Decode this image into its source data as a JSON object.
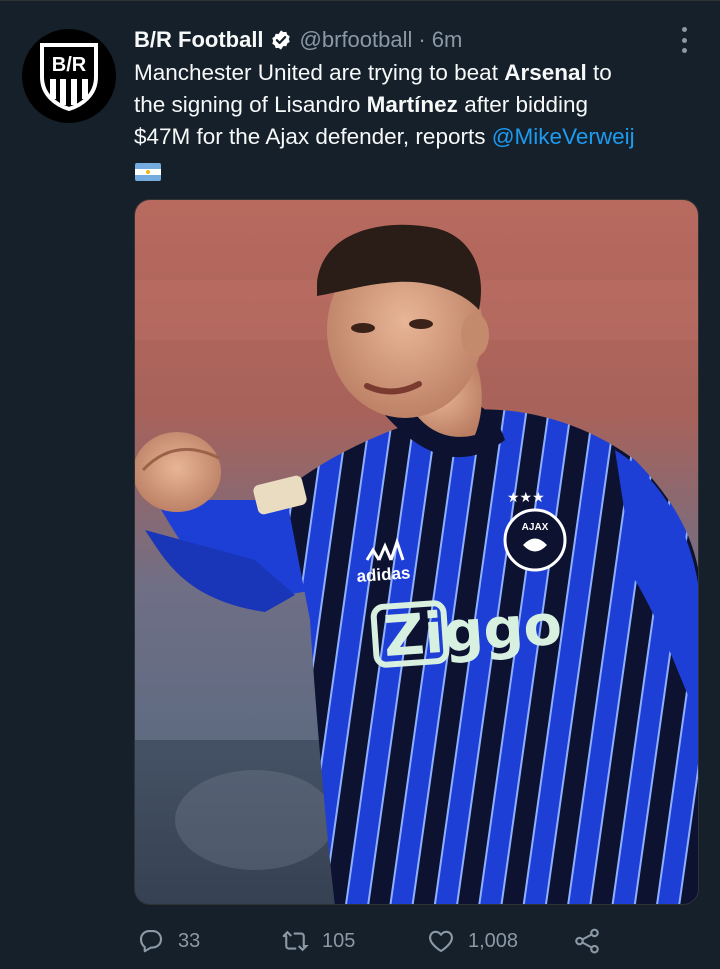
{
  "tweet": {
    "author": {
      "display_name": "B/R Football",
      "handle": "@brfootball",
      "separator": "·",
      "time": "6m",
      "avatar_text": "B/R",
      "verified": true
    },
    "text": {
      "l1_a": "Manchester United are trying to beat ",
      "l1_b": "Arsenal",
      "l1_c": " to",
      "l2_a": "the signing of Lisandro ",
      "l2_b": "Martínez",
      "l2_c": " after bidding",
      "l3_a": "$47M for the Ajax defender, reports ",
      "l3_mention": "@MikeVerweij"
    },
    "flag": "argentina-flag",
    "media": {
      "jersey_sponsor": "Ziggo",
      "kit_brand": "adidas",
      "club_crest": "AJAX"
    },
    "actions": {
      "replies": "33",
      "retweets": "105",
      "likes": "1,008"
    }
  },
  "colors": {
    "background": "#15202b",
    "text": "#f7f9f9",
    "secondary": "#8b98a5",
    "link": "#1d9bf0",
    "verified_badge": "#ffffff",
    "kit_blue": "#1e3fd6",
    "kit_navy": "#0d1230"
  },
  "icons": {
    "verified": "verified-badge-icon",
    "more": "more-dots-icon",
    "reply": "reply-icon",
    "retweet": "retweet-icon",
    "like": "heart-icon",
    "share": "share-icon"
  }
}
